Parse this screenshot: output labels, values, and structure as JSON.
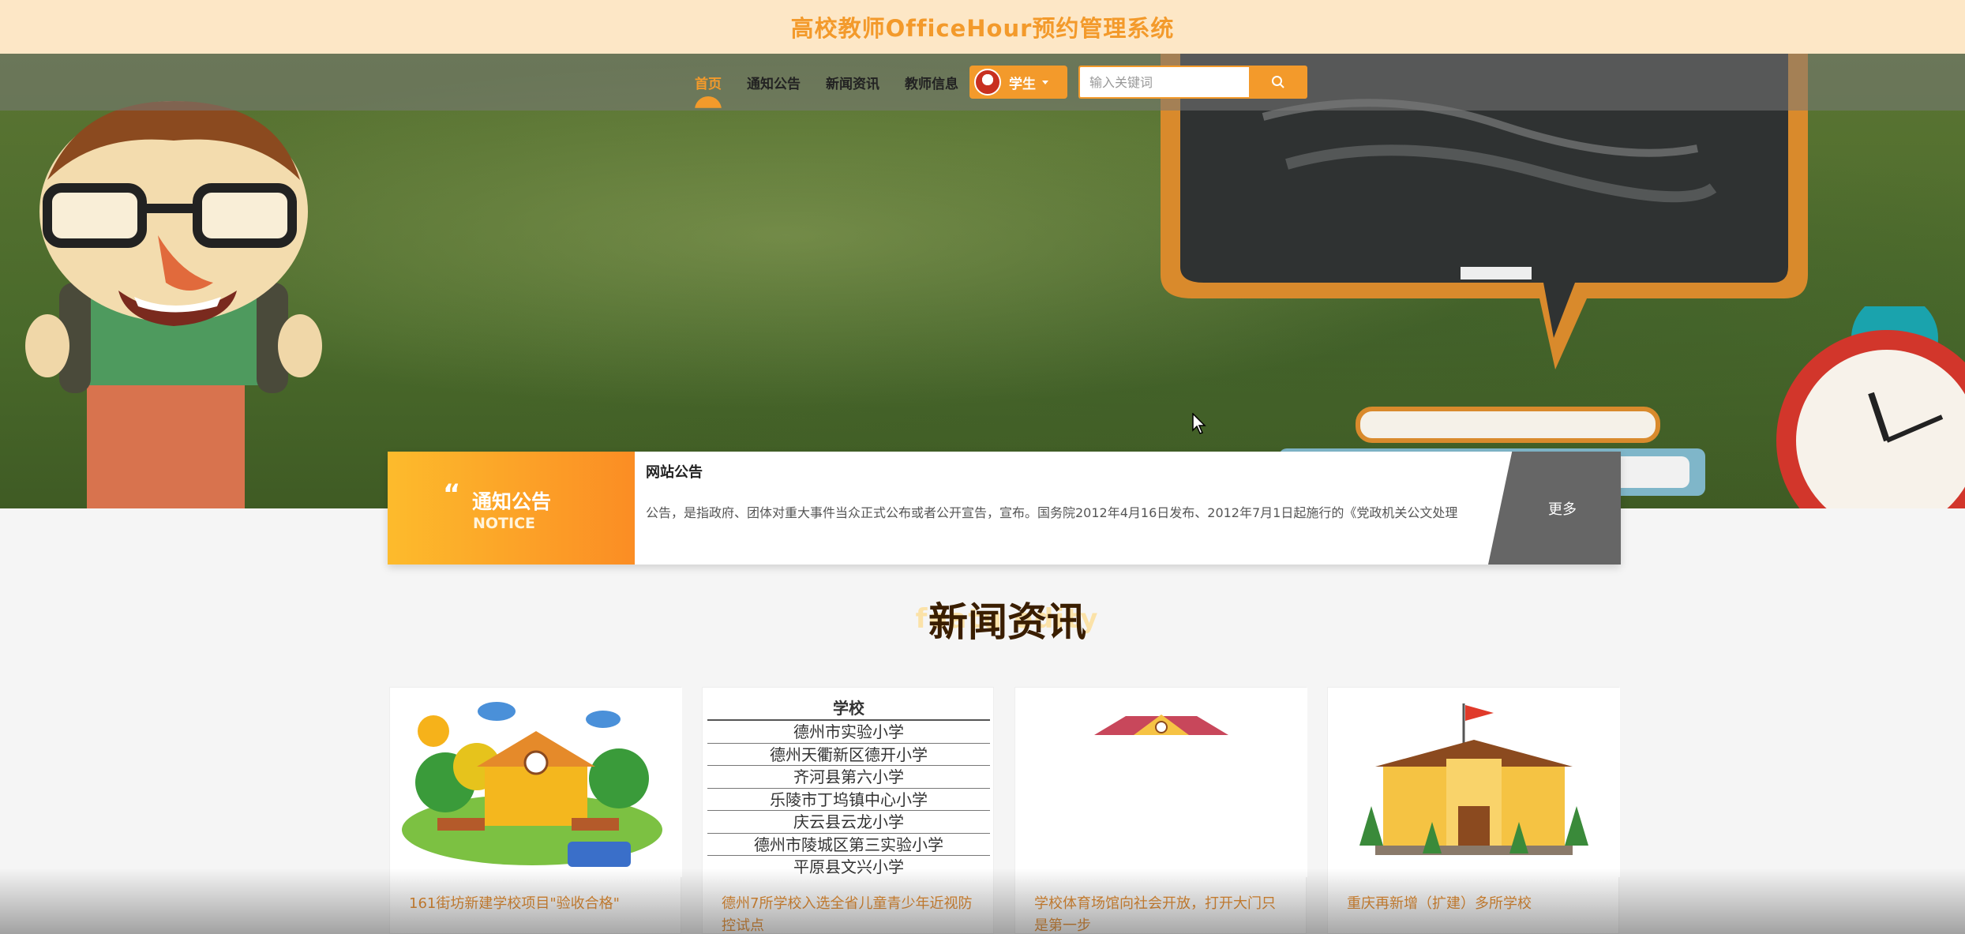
{
  "header": {
    "title": "高校教师OfficeHour预约管理系统"
  },
  "nav": {
    "items": [
      {
        "label": "首页",
        "active": true
      },
      {
        "label": "通知公告",
        "active": false
      },
      {
        "label": "新闻资讯",
        "active": false
      },
      {
        "label": "教师信息",
        "active": false
      }
    ],
    "user_label": "学生",
    "search_placeholder": "输入关键词"
  },
  "notice": {
    "label": "通知公告",
    "label_en": "NOTICE",
    "title": "网站公告",
    "text": "公告，是指政府、团体对重大事件当众正式公布或者公开宣告，宣布。国务院2012年4月16日发布、2012年7月1日起施行的《党政机关公文处理",
    "more_label": "更多"
  },
  "news": {
    "title": "新闻资讯",
    "title_bg": "featu          odity",
    "items": [
      {
        "title": "161街坊新建学校项目\"验收合格\""
      },
      {
        "title": "德州7所学校入选全省儿童青少年近视防控试点"
      },
      {
        "title": "学校体育场馆向社会开放，打开大门只是第一步"
      },
      {
        "title": "重庆再新增（扩建）多所学校"
      }
    ],
    "school_list_heading": "学校",
    "school_list": [
      "德州市实验小学",
      "德州天衢新区德开小学",
      "齐河县第六小学",
      "乐陵市丁坞镇中心小学",
      "庆云县云龙小学",
      "德州市陵城区第三实验小学",
      "平原县文兴小学"
    ]
  },
  "colors": {
    "accent": "#f39a2b",
    "topbar": "#fde7c6",
    "heading": "#3a1e00"
  }
}
